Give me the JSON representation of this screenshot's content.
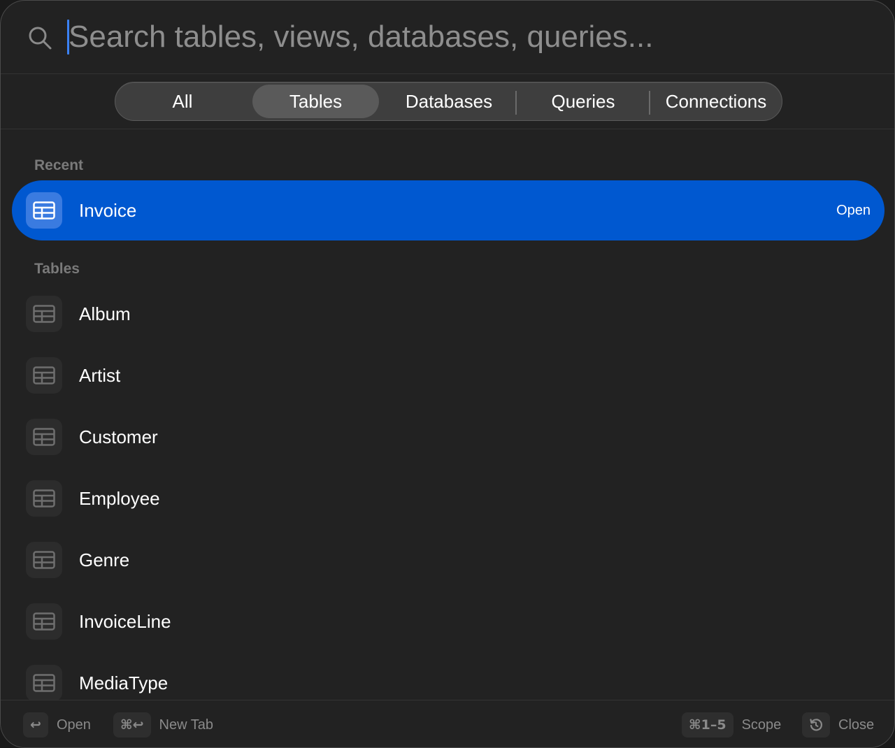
{
  "search": {
    "placeholder": "Search tables, views, databases, queries..."
  },
  "tabs": [
    {
      "label": "All",
      "active": false
    },
    {
      "label": "Tables",
      "active": true
    },
    {
      "label": "Databases",
      "active": false
    },
    {
      "label": "Queries",
      "active": false
    },
    {
      "label": "Connections",
      "active": false
    }
  ],
  "sections": {
    "recent": {
      "label": "Recent",
      "items": [
        {
          "label": "Invoice",
          "icon": "table-icon",
          "action": "Open",
          "selected": true
        }
      ]
    },
    "tables": {
      "label": "Tables",
      "items": [
        {
          "label": "Album",
          "icon": "table-icon"
        },
        {
          "label": "Artist",
          "icon": "table-icon"
        },
        {
          "label": "Customer",
          "icon": "table-icon"
        },
        {
          "label": "Employee",
          "icon": "table-icon"
        },
        {
          "label": "Genre",
          "icon": "table-icon"
        },
        {
          "label": "InvoiceLine",
          "icon": "table-icon"
        },
        {
          "label": "MediaType",
          "icon": "table-icon"
        }
      ]
    }
  },
  "footer": {
    "open": {
      "key": "↩",
      "label": "Open"
    },
    "new_tab": {
      "key": "⌘↩",
      "label": "New Tab"
    },
    "scope": {
      "key": "⌘1–5",
      "label": "Scope"
    },
    "close": {
      "key": "history-icon",
      "label": "Close"
    }
  },
  "colors": {
    "accent": "#0058d0",
    "background": "#222222",
    "caret": "#3b82f6"
  }
}
